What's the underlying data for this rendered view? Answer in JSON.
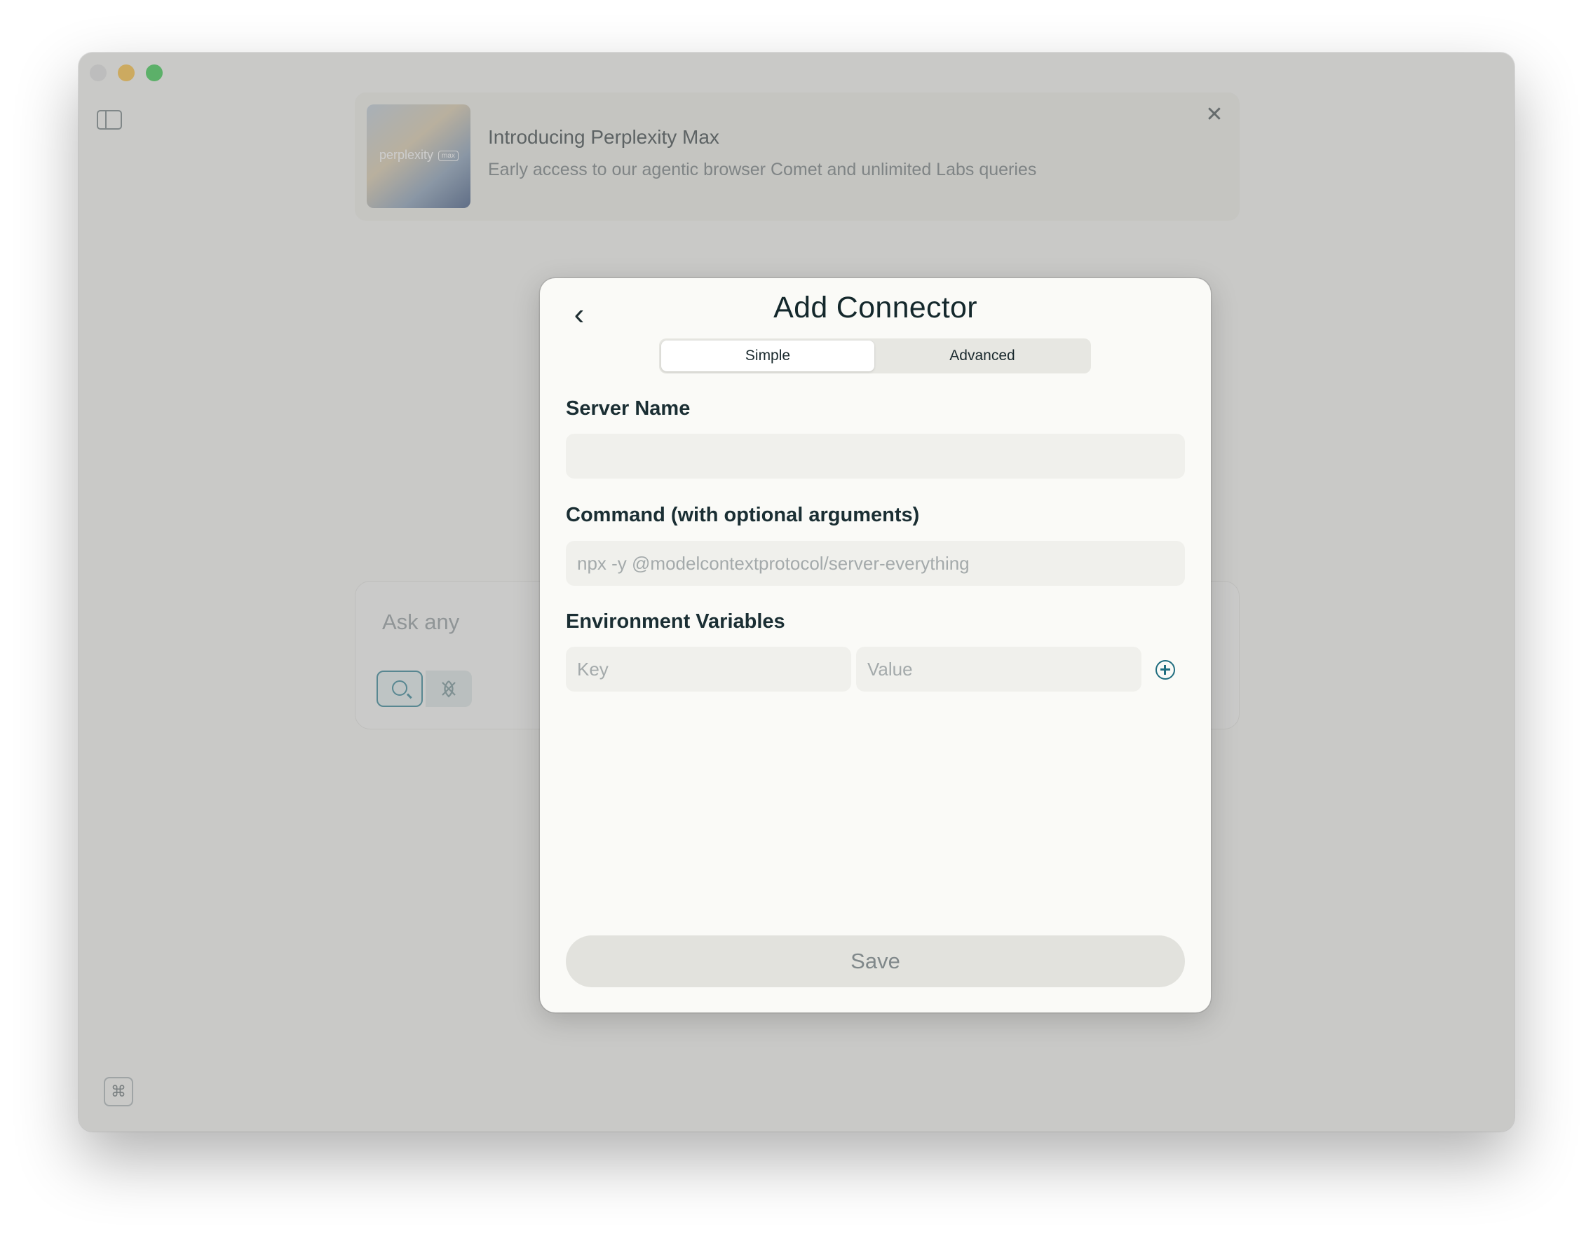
{
  "banner": {
    "thumb_text": "perplexity",
    "thumb_badge": "max",
    "title": "Introducing Perplexity Max",
    "subtitle": "Early access to our agentic browser Comet and unlimited Labs queries",
    "close_glyph": "✕"
  },
  "ask": {
    "placeholder": "Ask any"
  },
  "shortcut": {
    "glyph": "⌘"
  },
  "modal": {
    "back_glyph": "‹",
    "title": "Add Connector",
    "tabs": {
      "simple": "Simple",
      "advanced": "Advanced",
      "selected": "Simple"
    },
    "server_name": {
      "label": "Server Name",
      "value": "",
      "placeholder": ""
    },
    "command": {
      "label": "Command (with optional arguments)",
      "value": "",
      "placeholder": "npx -y @modelcontextprotocol/server-everything"
    },
    "env": {
      "label": "Environment Variables",
      "key_placeholder": "Key",
      "value_placeholder": "Value"
    },
    "save_label": "Save"
  },
  "icons": {
    "sidebar": "sidebar-toggle-icon",
    "close": "close-icon",
    "back": "chevron-left-icon",
    "add": "plus-circle-icon",
    "search": "search-icon",
    "mic": "microphone-icon",
    "window": "browser-window-icon"
  },
  "colors": {
    "accent": "#1f6d7f",
    "traffic_min": "#febc2e",
    "traffic_max": "#28c840"
  }
}
